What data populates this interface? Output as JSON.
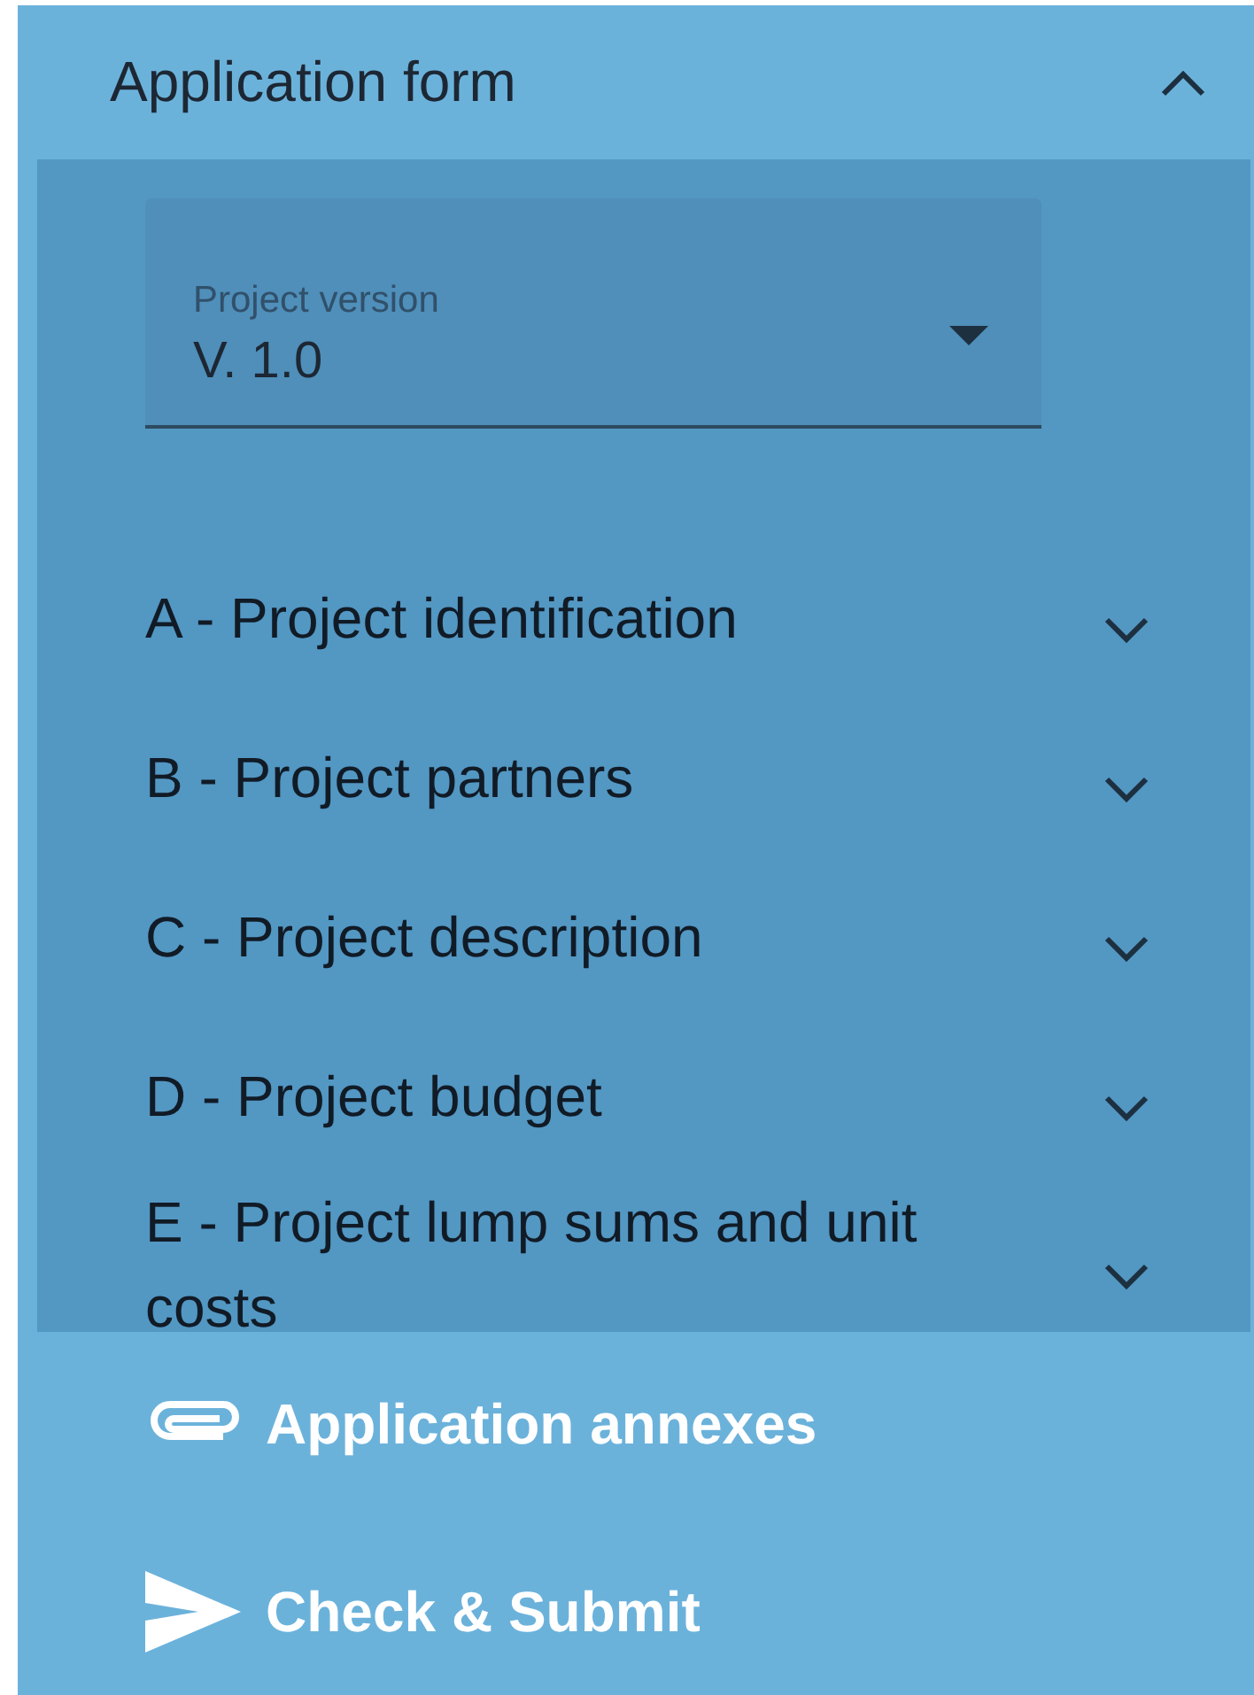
{
  "panel": {
    "title": "Application form",
    "expanded": true
  },
  "version_select": {
    "label": "Project version",
    "value": "V. 1.0"
  },
  "sections": [
    {
      "label": "A - Project identification",
      "expanded": false
    },
    {
      "label": "B - Project partners",
      "expanded": false
    },
    {
      "label": "C - Project description",
      "expanded": false
    },
    {
      "label": "D - Project budget",
      "expanded": false
    },
    {
      "label": "E - Project lump sums and unit costs",
      "expanded": false
    }
  ],
  "links": [
    {
      "kind": "attachment",
      "label": "Application annexes"
    },
    {
      "kind": "send",
      "label": "Check & Submit"
    }
  ]
}
